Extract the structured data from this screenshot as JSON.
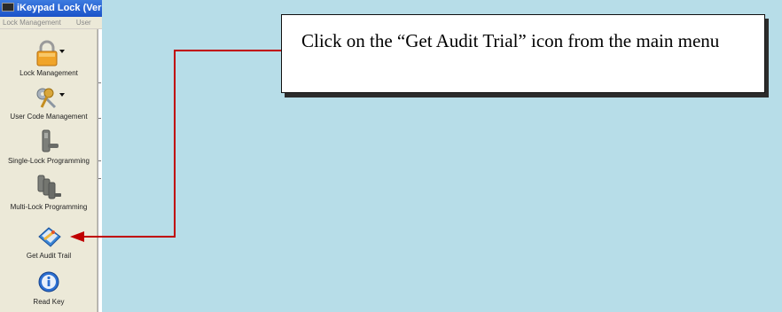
{
  "window": {
    "title": "iKeypad Lock (Ver",
    "menu": [
      "Lock Management",
      "User"
    ]
  },
  "sidebar": {
    "items": [
      {
        "label": "Lock Management",
        "icon": "padlock-icon"
      },
      {
        "label": "User Code Management",
        "icon": "keys-icon"
      },
      {
        "label": "Single-Lock Programming",
        "icon": "single-lock-icon"
      },
      {
        "label": "Multi-Lock Programming",
        "icon": "multi-lock-icon"
      },
      {
        "label": "Get Audit Trail",
        "icon": "audit-trail-icon"
      },
      {
        "label": "Read Key",
        "icon": "info-icon"
      }
    ]
  },
  "callout": {
    "text": "Click on the “Get Audit Trial” icon from the main menu"
  },
  "colors": {
    "background": "#b7dde8",
    "arrow": "#c00000",
    "titlebar": "#1b52c8"
  }
}
